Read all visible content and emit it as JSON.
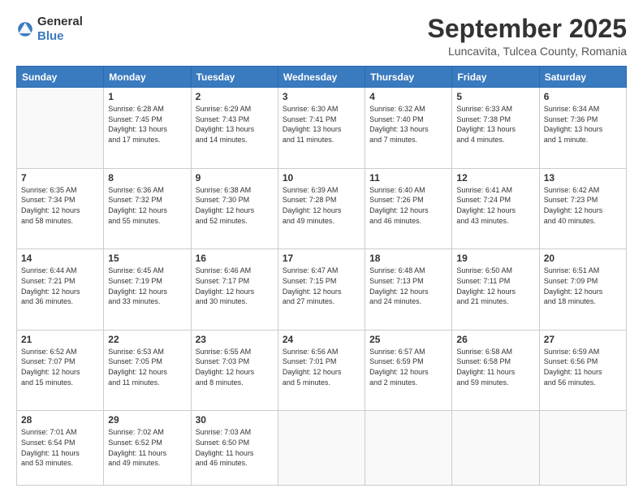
{
  "header": {
    "logo_general": "General",
    "logo_blue": "Blue",
    "month_title": "September 2025",
    "location": "Luncavita, Tulcea County, Romania"
  },
  "days_of_week": [
    "Sunday",
    "Monday",
    "Tuesday",
    "Wednesday",
    "Thursday",
    "Friday",
    "Saturday"
  ],
  "weeks": [
    [
      {
        "day": "",
        "info": ""
      },
      {
        "day": "1",
        "info": "Sunrise: 6:28 AM\nSunset: 7:45 PM\nDaylight: 13 hours\nand 17 minutes."
      },
      {
        "day": "2",
        "info": "Sunrise: 6:29 AM\nSunset: 7:43 PM\nDaylight: 13 hours\nand 14 minutes."
      },
      {
        "day": "3",
        "info": "Sunrise: 6:30 AM\nSunset: 7:41 PM\nDaylight: 13 hours\nand 11 minutes."
      },
      {
        "day": "4",
        "info": "Sunrise: 6:32 AM\nSunset: 7:40 PM\nDaylight: 13 hours\nand 7 minutes."
      },
      {
        "day": "5",
        "info": "Sunrise: 6:33 AM\nSunset: 7:38 PM\nDaylight: 13 hours\nand 4 minutes."
      },
      {
        "day": "6",
        "info": "Sunrise: 6:34 AM\nSunset: 7:36 PM\nDaylight: 13 hours\nand 1 minute."
      }
    ],
    [
      {
        "day": "7",
        "info": "Sunrise: 6:35 AM\nSunset: 7:34 PM\nDaylight: 12 hours\nand 58 minutes."
      },
      {
        "day": "8",
        "info": "Sunrise: 6:36 AM\nSunset: 7:32 PM\nDaylight: 12 hours\nand 55 minutes."
      },
      {
        "day": "9",
        "info": "Sunrise: 6:38 AM\nSunset: 7:30 PM\nDaylight: 12 hours\nand 52 minutes."
      },
      {
        "day": "10",
        "info": "Sunrise: 6:39 AM\nSunset: 7:28 PM\nDaylight: 12 hours\nand 49 minutes."
      },
      {
        "day": "11",
        "info": "Sunrise: 6:40 AM\nSunset: 7:26 PM\nDaylight: 12 hours\nand 46 minutes."
      },
      {
        "day": "12",
        "info": "Sunrise: 6:41 AM\nSunset: 7:24 PM\nDaylight: 12 hours\nand 43 minutes."
      },
      {
        "day": "13",
        "info": "Sunrise: 6:42 AM\nSunset: 7:23 PM\nDaylight: 12 hours\nand 40 minutes."
      }
    ],
    [
      {
        "day": "14",
        "info": "Sunrise: 6:44 AM\nSunset: 7:21 PM\nDaylight: 12 hours\nand 36 minutes."
      },
      {
        "day": "15",
        "info": "Sunrise: 6:45 AM\nSunset: 7:19 PM\nDaylight: 12 hours\nand 33 minutes."
      },
      {
        "day": "16",
        "info": "Sunrise: 6:46 AM\nSunset: 7:17 PM\nDaylight: 12 hours\nand 30 minutes."
      },
      {
        "day": "17",
        "info": "Sunrise: 6:47 AM\nSunset: 7:15 PM\nDaylight: 12 hours\nand 27 minutes."
      },
      {
        "day": "18",
        "info": "Sunrise: 6:48 AM\nSunset: 7:13 PM\nDaylight: 12 hours\nand 24 minutes."
      },
      {
        "day": "19",
        "info": "Sunrise: 6:50 AM\nSunset: 7:11 PM\nDaylight: 12 hours\nand 21 minutes."
      },
      {
        "day": "20",
        "info": "Sunrise: 6:51 AM\nSunset: 7:09 PM\nDaylight: 12 hours\nand 18 minutes."
      }
    ],
    [
      {
        "day": "21",
        "info": "Sunrise: 6:52 AM\nSunset: 7:07 PM\nDaylight: 12 hours\nand 15 minutes."
      },
      {
        "day": "22",
        "info": "Sunrise: 6:53 AM\nSunset: 7:05 PM\nDaylight: 12 hours\nand 11 minutes."
      },
      {
        "day": "23",
        "info": "Sunrise: 6:55 AM\nSunset: 7:03 PM\nDaylight: 12 hours\nand 8 minutes."
      },
      {
        "day": "24",
        "info": "Sunrise: 6:56 AM\nSunset: 7:01 PM\nDaylight: 12 hours\nand 5 minutes."
      },
      {
        "day": "25",
        "info": "Sunrise: 6:57 AM\nSunset: 6:59 PM\nDaylight: 12 hours\nand 2 minutes."
      },
      {
        "day": "26",
        "info": "Sunrise: 6:58 AM\nSunset: 6:58 PM\nDaylight: 11 hours\nand 59 minutes."
      },
      {
        "day": "27",
        "info": "Sunrise: 6:59 AM\nSunset: 6:56 PM\nDaylight: 11 hours\nand 56 minutes."
      }
    ],
    [
      {
        "day": "28",
        "info": "Sunrise: 7:01 AM\nSunset: 6:54 PM\nDaylight: 11 hours\nand 53 minutes."
      },
      {
        "day": "29",
        "info": "Sunrise: 7:02 AM\nSunset: 6:52 PM\nDaylight: 11 hours\nand 49 minutes."
      },
      {
        "day": "30",
        "info": "Sunrise: 7:03 AM\nSunset: 6:50 PM\nDaylight: 11 hours\nand 46 minutes."
      },
      {
        "day": "",
        "info": ""
      },
      {
        "day": "",
        "info": ""
      },
      {
        "day": "",
        "info": ""
      },
      {
        "day": "",
        "info": ""
      }
    ]
  ]
}
